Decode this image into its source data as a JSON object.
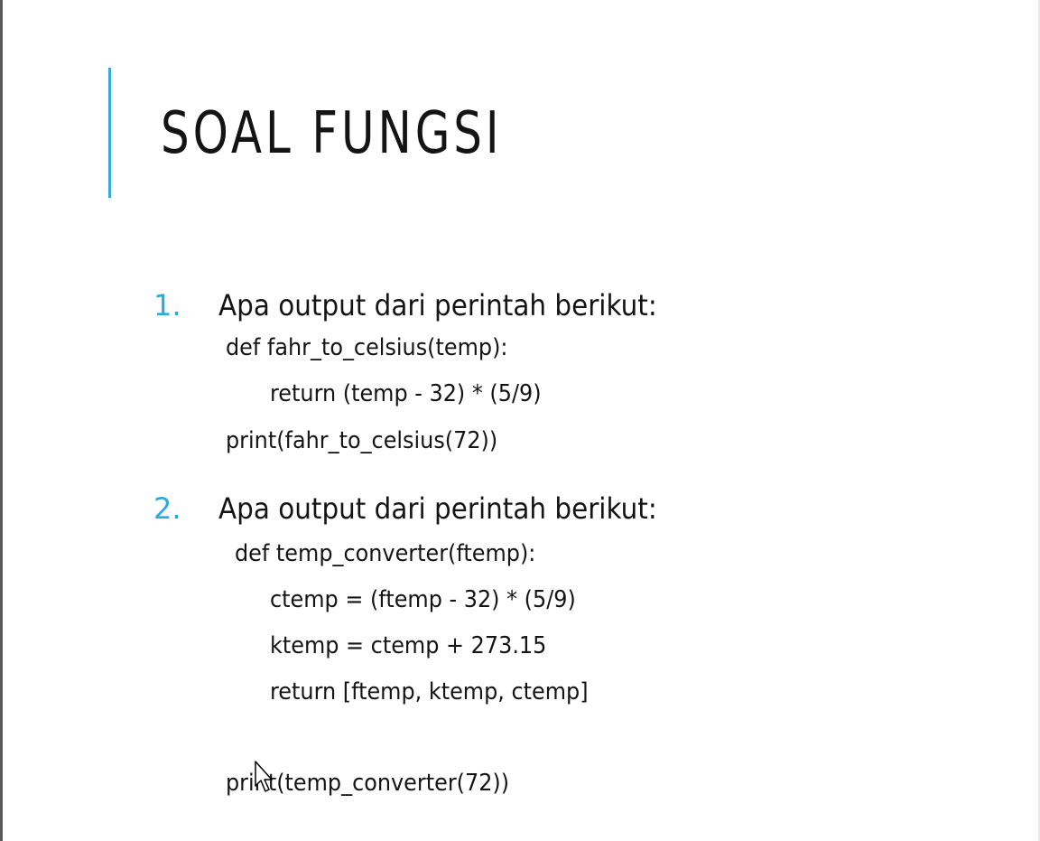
{
  "slide": {
    "title": "SOAL FUNGSI",
    "accent_color": "#39a9dc",
    "number_color": "#2ea8dd"
  },
  "questions": [
    {
      "number": "1.",
      "prompt": "Apa output dari perintah berikut:",
      "code": [
        "def fahr_to_celsius(temp):",
        "return (temp - 32) * (5/9)",
        "print(fahr_to_celsius(72))"
      ]
    },
    {
      "number": "2.",
      "prompt": "Apa output dari perintah berikut:",
      "code": [
        "def temp_converter(ftemp):",
        "ctemp = (ftemp - 32) * (5/9)",
        "ktemp = ctemp + 273.15",
        "return [ftemp, ktemp, ctemp]",
        "print(temp_converter(72))"
      ]
    }
  ],
  "cursor_icon": "mouse-pointer-icon"
}
